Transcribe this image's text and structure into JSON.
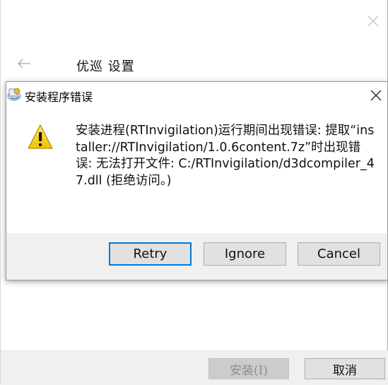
{
  "installer": {
    "title": "优巡 设置",
    "install_label": "安装(I)",
    "cancel_label": "取消"
  },
  "error_dialog": {
    "title": "安装程序错误",
    "message": "安装进程(RTInvigilation)运行期间出现错误: 提取“installer://RTInvigilation/1.0.6content.7z”时出现错误: 无法打开文件: C:/RTInvigilation/d3dcompiler_47.dll (拒绝访问。)",
    "buttons": {
      "retry": "Retry",
      "ignore": "Ignore",
      "cancel": "Cancel"
    }
  },
  "icons": {
    "installer_close": "close-icon",
    "back": "back-arrow-icon",
    "dialog_app": "installer-app-icon",
    "dialog_close": "close-icon",
    "warning": "warning-icon"
  },
  "colors": {
    "focus_border": "#0078d7",
    "button_bar": "#f0f0f0",
    "warning_yellow": "#f5d21c"
  }
}
